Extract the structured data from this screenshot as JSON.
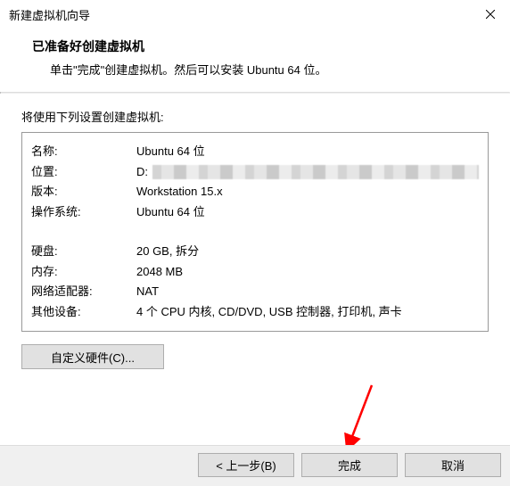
{
  "titlebar": {
    "title": "新建虚拟机向导"
  },
  "header": {
    "heading": "已准备好创建虚拟机",
    "subheading": "单击\"完成\"创建虚拟机。然后可以安装 Ubuntu 64 位。"
  },
  "list_caption": "将使用下列设置创建虚拟机:",
  "summary": {
    "name": {
      "label": "名称:",
      "value": "Ubuntu 64 位"
    },
    "location": {
      "label": "位置:",
      "value": "D:"
    },
    "version": {
      "label": "版本:",
      "value": "Workstation 15.x"
    },
    "os": {
      "label": "操作系统:",
      "value": "Ubuntu 64 位"
    },
    "disk": {
      "label": "硬盘:",
      "value": "20 GB, 拆分"
    },
    "memory": {
      "label": "内存:",
      "value": "2048 MB"
    },
    "net": {
      "label": "网络适配器:",
      "value": "NAT"
    },
    "other": {
      "label": "其他设备:",
      "value": "4 个 CPU 内核, CD/DVD, USB 控制器, 打印机, 声卡"
    }
  },
  "buttons": {
    "customize_hw": "自定义硬件(C)...",
    "back": "< 上一步(B)",
    "finish": "完成",
    "cancel": "取消"
  }
}
